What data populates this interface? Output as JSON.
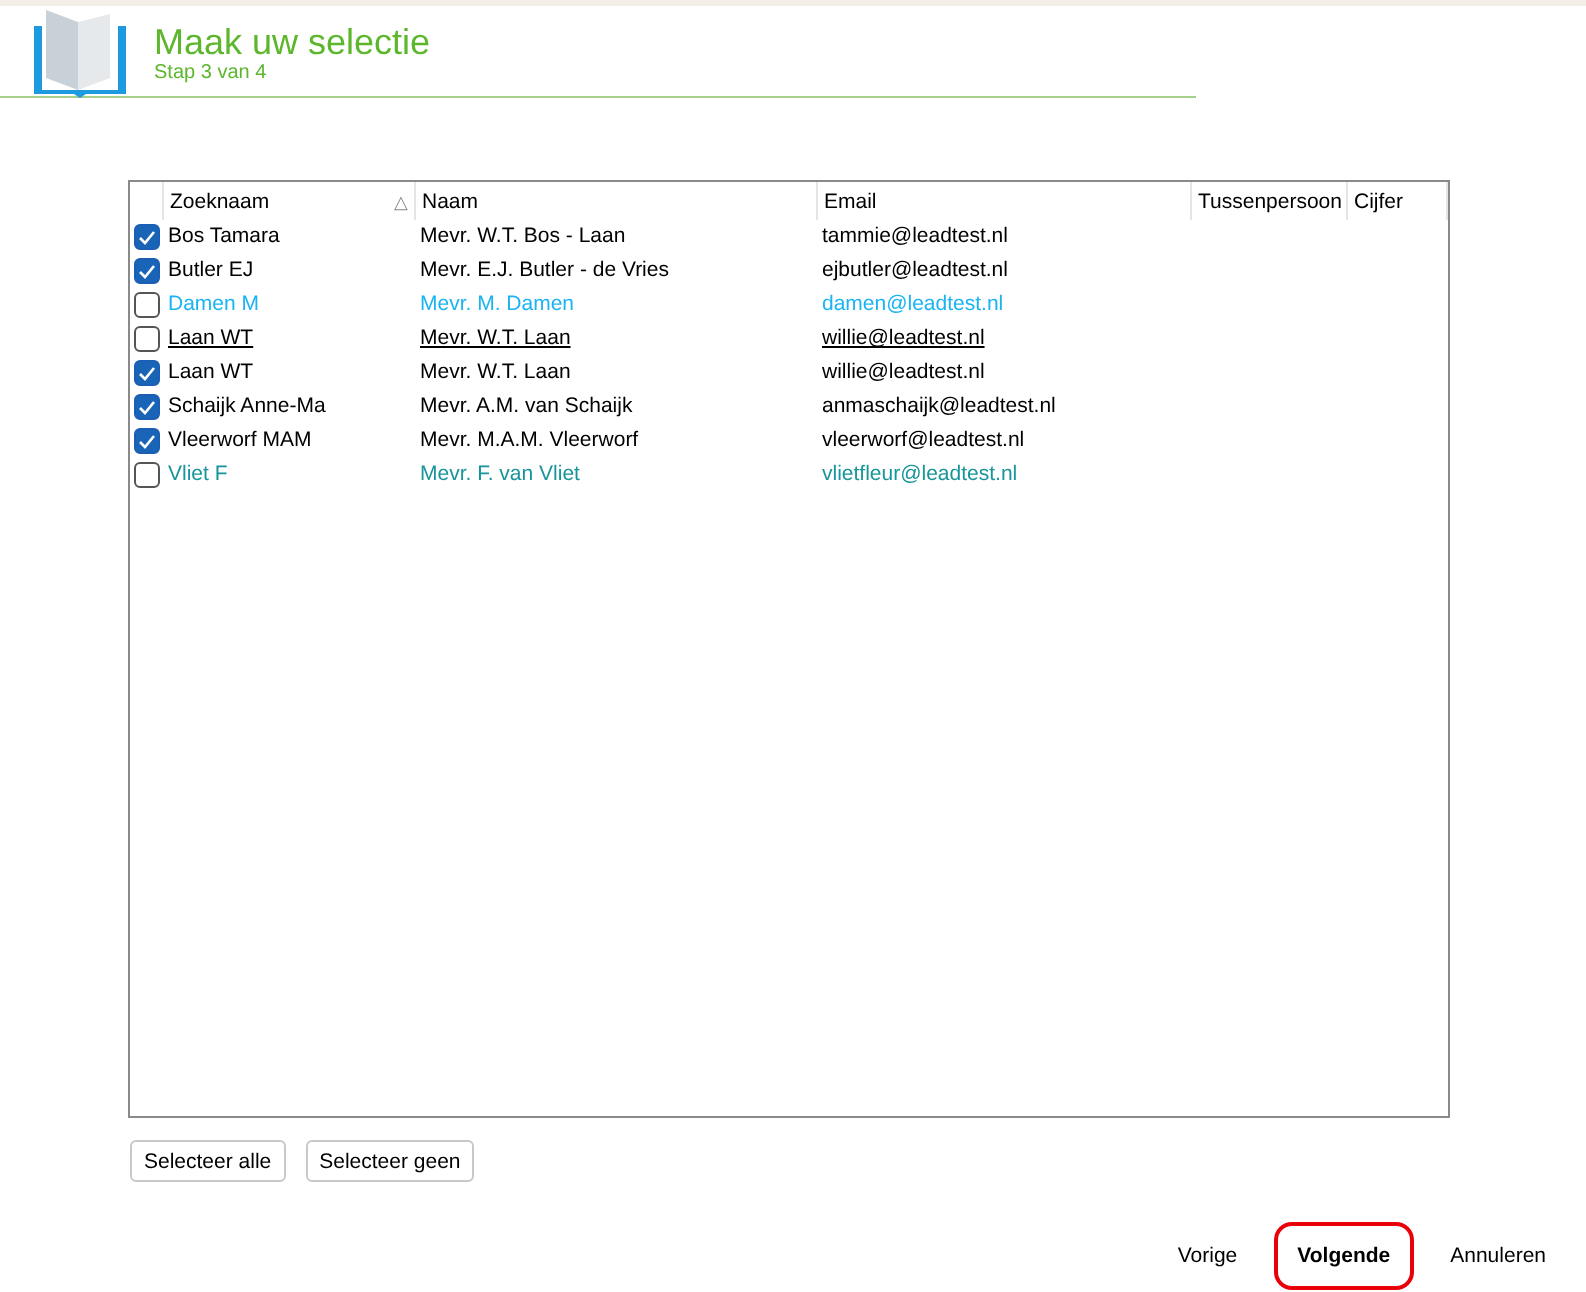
{
  "header": {
    "title": "Maak uw selectie",
    "subtitle": "Stap 3 van 4"
  },
  "table": {
    "columns": [
      {
        "label": "Zoeknaam",
        "sort_mark": "△"
      },
      {
        "label": "Naam"
      },
      {
        "label": "Email"
      },
      {
        "label": "Tussenpersoon"
      },
      {
        "label": "Cijfer"
      }
    ],
    "rows": [
      {
        "checked": true,
        "underlined": false,
        "color": "#000000",
        "cells": [
          "Bos Tamara",
          "Mevr. W.T. Bos - Laan",
          "tammie@leadtest.nl"
        ]
      },
      {
        "checked": true,
        "underlined": false,
        "color": "#000000",
        "cells": [
          "Butler EJ",
          "Mevr. E.J. Butler - de Vries",
          "ejbutler@leadtest.nl"
        ]
      },
      {
        "checked": false,
        "underlined": false,
        "color": "#1ab4f2",
        "cells": [
          "Damen M",
          "Mevr. M. Damen",
          "damen@leadtest.nl"
        ]
      },
      {
        "checked": false,
        "underlined": true,
        "color": "#000000",
        "cells": [
          "Laan WT",
          "Mevr. W.T. Laan",
          "willie@leadtest.nl"
        ]
      },
      {
        "checked": true,
        "underlined": false,
        "color": "#000000",
        "cells": [
          "Laan WT",
          "Mevr. W.T. Laan",
          "willie@leadtest.nl"
        ]
      },
      {
        "checked": true,
        "underlined": false,
        "color": "#000000",
        "cells": [
          "Schaijk Anne-Ma",
          "Mevr. A.M. van Schaijk",
          "anmaschaijk@leadtest.nl"
        ]
      },
      {
        "checked": true,
        "underlined": false,
        "color": "#000000",
        "cells": [
          "Vleerworf MAM",
          "Mevr. M.A.M. Vleerworf",
          "vleerworf@leadtest.nl"
        ]
      },
      {
        "checked": false,
        "underlined": false,
        "color": "#17959a",
        "cells": [
          "Vliet F",
          "Mevr. F. van Vliet",
          "vlietfleur@leadtest.nl"
        ]
      }
    ]
  },
  "selection_buttons": [
    "Selecteer alle",
    "Selecteer geen"
  ],
  "nav_buttons": [
    {
      "label": "Vorige",
      "highlighted": false,
      "bold": false
    },
    {
      "label": "Volgende",
      "highlighted": true,
      "bold": true
    },
    {
      "label": "Annuleren",
      "highlighted": false,
      "bold": false
    }
  ]
}
